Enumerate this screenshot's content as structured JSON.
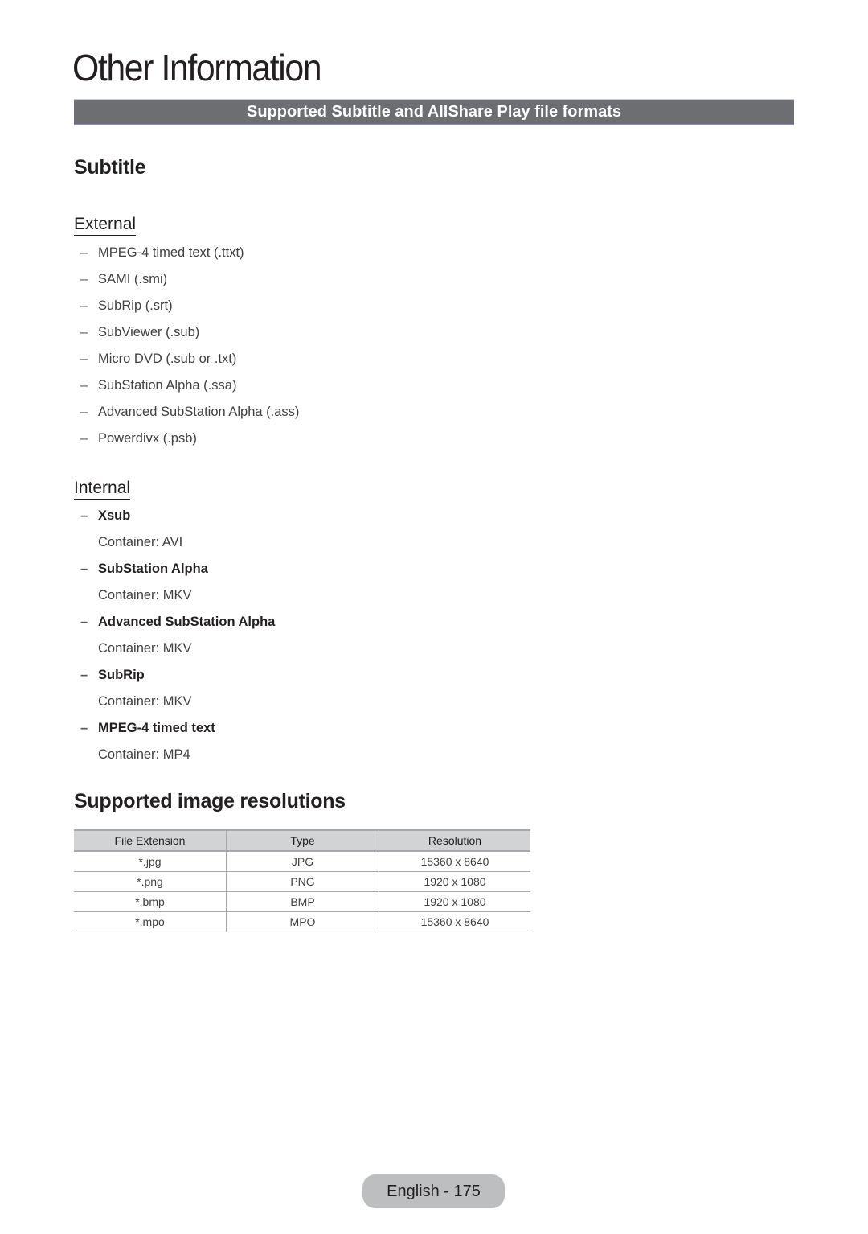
{
  "page": {
    "title": "Other Information",
    "banner": "Supported Subtitle and AllShare Play file formats",
    "footer": "English - 175"
  },
  "subtitle": {
    "heading": "Subtitle",
    "external": {
      "heading": "External",
      "items": [
        "MPEG-4 timed text (.ttxt)",
        "SAMI (.smi)",
        "SubRip (.srt)",
        "SubViewer (.sub)",
        "Micro DVD (.sub or .txt)",
        "SubStation Alpha (.ssa)",
        "Advanced SubStation Alpha (.ass)",
        "Powerdivx (.psb)"
      ]
    },
    "internal": {
      "heading": "Internal",
      "items": [
        {
          "name": "Xsub",
          "container": "Container: AVI"
        },
        {
          "name": "SubStation Alpha",
          "container": "Container: MKV"
        },
        {
          "name": "Advanced SubStation Alpha",
          "container": "Container: MKV"
        },
        {
          "name": "SubRip",
          "container": "Container: MKV"
        },
        {
          "name": "MPEG-4 timed text",
          "container": "Container: MP4"
        }
      ]
    }
  },
  "image_resolutions": {
    "heading": "Supported image resolutions",
    "columns": [
      "File Extension",
      "Type",
      "Resolution"
    ],
    "rows": [
      [
        "*.jpg",
        "JPG",
        "15360 x 8640"
      ],
      [
        "*.png",
        "PNG",
        "1920 x 1080"
      ],
      [
        "*.bmp",
        "BMP",
        "1920 x 1080"
      ],
      [
        "*.mpo",
        "MPO",
        "15360 x 8640"
      ]
    ]
  },
  "colors": {
    "banner_bg": "#6d6e71",
    "table_header_bg": "#d1d3d4",
    "footer_pill_bg": "#bcbec0",
    "text": "#231f20"
  },
  "icons": {
    "bullet": "en-dash"
  }
}
